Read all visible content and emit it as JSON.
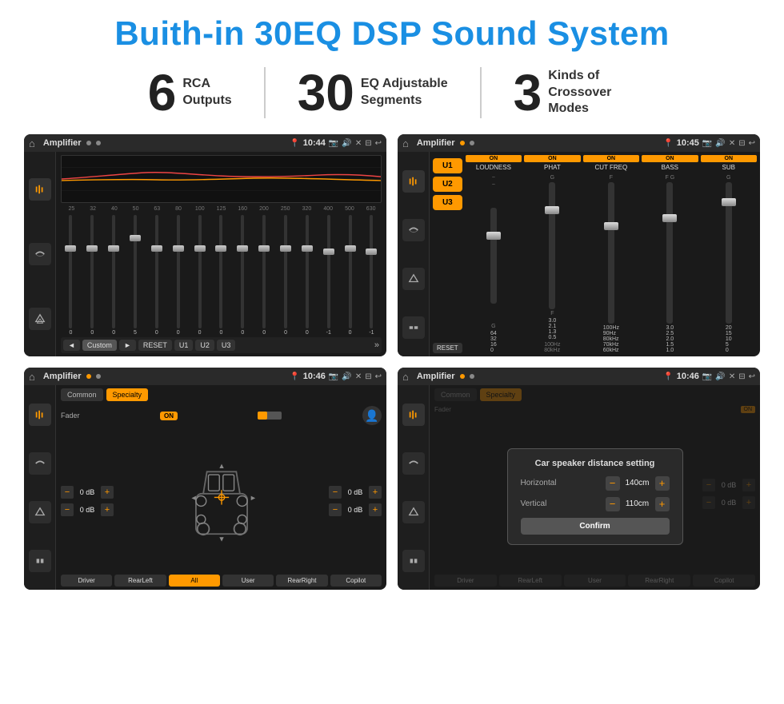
{
  "header": {
    "title": "Buith-in 30EQ DSP Sound System"
  },
  "stats": [
    {
      "number": "6",
      "label": "RCA\nOutputs"
    },
    {
      "number": "30",
      "label": "EQ Adjustable\nSegments"
    },
    {
      "number": "3",
      "label": "Kinds of\nCrossover Modes"
    }
  ],
  "screens": [
    {
      "id": "eq-screen",
      "title": "Amplifier",
      "time": "10:44",
      "type": "eq"
    },
    {
      "id": "crossover-screen",
      "title": "Amplifier",
      "time": "10:45",
      "type": "crossover"
    },
    {
      "id": "fader-screen",
      "title": "Amplifier",
      "time": "10:46",
      "type": "fader"
    },
    {
      "id": "dialog-screen",
      "title": "Amplifier",
      "time": "10:46",
      "type": "dialog"
    }
  ],
  "eq": {
    "frequencies": [
      "25",
      "32",
      "40",
      "50",
      "63",
      "80",
      "100",
      "125",
      "160",
      "200",
      "250",
      "320",
      "400",
      "500",
      "630"
    ],
    "values": [
      "0",
      "0",
      "0",
      "5",
      "0",
      "0",
      "0",
      "0",
      "0",
      "0",
      "0",
      "0",
      "-1",
      "0",
      "-1"
    ],
    "controls": [
      "◄",
      "Custom",
      "►",
      "RESET",
      "U1",
      "U2",
      "U3"
    ]
  },
  "crossover": {
    "u_buttons": [
      "U1",
      "U2",
      "U3"
    ],
    "channels": [
      {
        "on": true,
        "label": "LOUDNESS"
      },
      {
        "on": true,
        "label": "PHAT"
      },
      {
        "on": true,
        "label": "CUT FREQ"
      },
      {
        "on": true,
        "label": "BASS"
      },
      {
        "on": true,
        "label": "SUB"
      }
    ],
    "reset_label": "RESET"
  },
  "fader": {
    "tabs": [
      "Common",
      "Specialty"
    ],
    "fader_label": "Fader",
    "on_label": "ON",
    "volumes": [
      "0 dB",
      "0 dB",
      "0 dB",
      "0 dB"
    ],
    "buttons": [
      "Driver",
      "RearLeft",
      "All",
      "User",
      "RearRight",
      "Copilot"
    ]
  },
  "dialog": {
    "title": "Car speaker distance setting",
    "fields": [
      {
        "label": "Horizontal",
        "value": "140cm"
      },
      {
        "label": "Vertical",
        "value": "110cm"
      }
    ],
    "confirm_label": "Confirm",
    "fader_tabs": [
      "Common",
      "Specialty"
    ],
    "on_label": "ON",
    "right_volumes": [
      "0 dB",
      "0 dB"
    ],
    "right_buttons": [
      "Driver",
      "RearLeft_",
      "All_",
      "User",
      "RearRight",
      "Copilot"
    ]
  }
}
